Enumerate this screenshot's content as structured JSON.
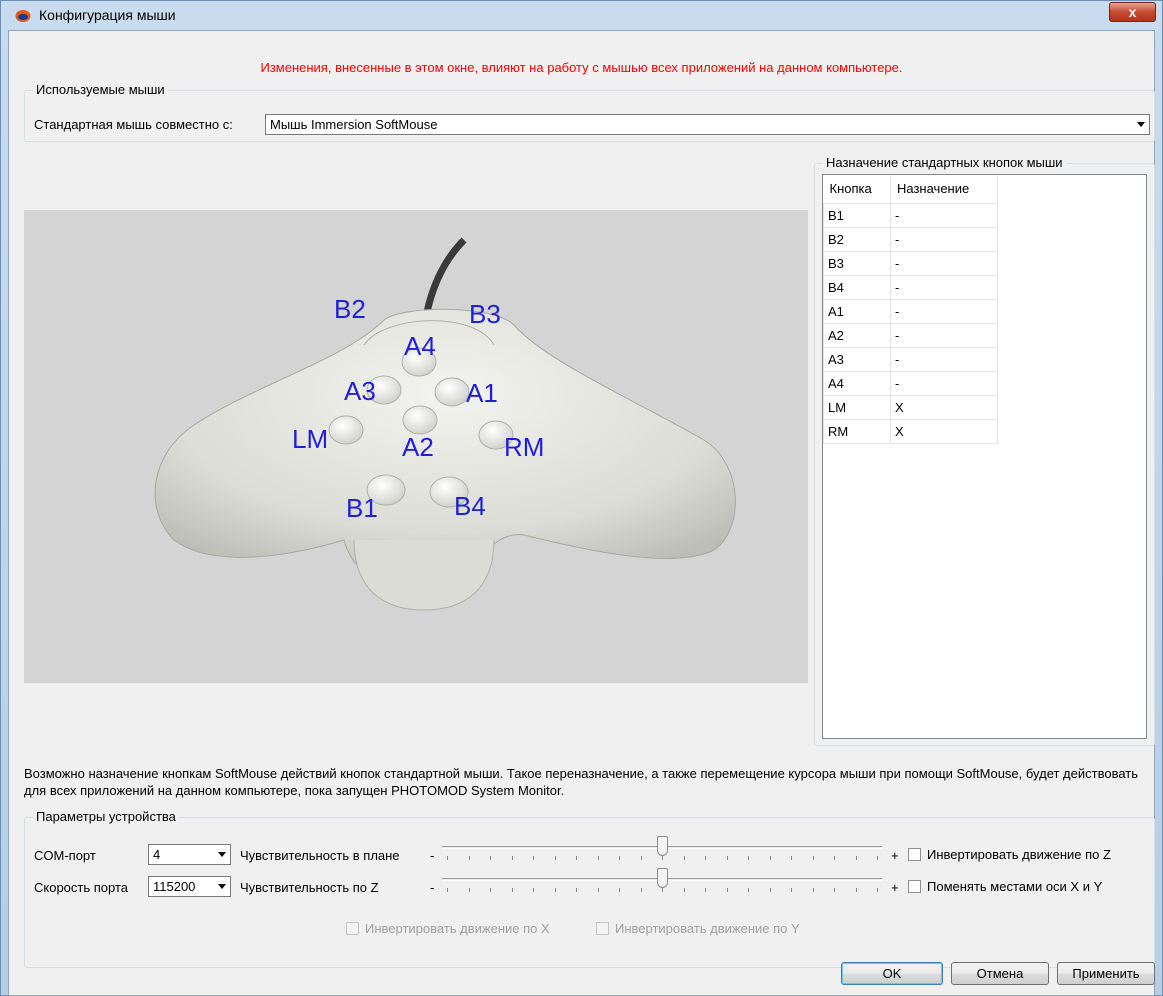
{
  "window": {
    "title": "Конфигурация мыши",
    "close_label": "x"
  },
  "warning": "Изменения, внесенные в этом окне, влияют на работу с мышью всех приложений на данном компьютере.",
  "mice_group": {
    "legend": "Используемые мыши",
    "label": "Стандартная мышь совместно с:",
    "selected": "Мышь Immersion SoftMouse"
  },
  "mouse_image": {
    "labels": {
      "B1": "B1",
      "B2": "B2",
      "B3": "B3",
      "B4": "B4",
      "A1": "A1",
      "A2": "A2",
      "A3": "A3",
      "A4": "A4",
      "LM": "LM",
      "RM": "RM"
    },
    "label_color": "#1f1fd6"
  },
  "assign_group": {
    "legend": "Назначение стандартных кнопок мыши",
    "columns": [
      "Кнопка",
      "Назначение"
    ],
    "rows": [
      [
        "B1",
        "-"
      ],
      [
        "B2",
        "-"
      ],
      [
        "B3",
        "-"
      ],
      [
        "B4",
        "-"
      ],
      [
        "A1",
        "-"
      ],
      [
        "A2",
        "-"
      ],
      [
        "A3",
        "-"
      ],
      [
        "A4",
        "-"
      ],
      [
        "LM",
        "X"
      ],
      [
        "RM",
        "X"
      ]
    ]
  },
  "description": "Возможно назначение кнопкам SoftMouse действий кнопок стандартной мыши. Такое переназначение, а также перемещение курсора мыши при помощи SoftMouse, будет действовать для всех приложений на данном компьютере, пока запущен PHOTOMOD System Monitor.",
  "device_group": {
    "legend": "Параметры устройства",
    "com_port_label": "COM-порт",
    "com_port_value": "4",
    "speed_label": "Скорость порта",
    "speed_value": "115200",
    "sens_plane_label": "Чувствительность в плане",
    "sens_z_label": "Чувствительность по Z",
    "minus": "-",
    "plus": "+",
    "sens_plane_value": 0.5,
    "sens_z_value": 0.5,
    "invert_z": "Инвертировать движение по Z",
    "swap_xy": "Поменять местами оси X и Y",
    "invert_x": "Инвертировать движение по X",
    "invert_y": "Инвертировать движение по Y"
  },
  "buttons": {
    "ok": "OK",
    "cancel": "Отмена",
    "apply": "Применить"
  }
}
